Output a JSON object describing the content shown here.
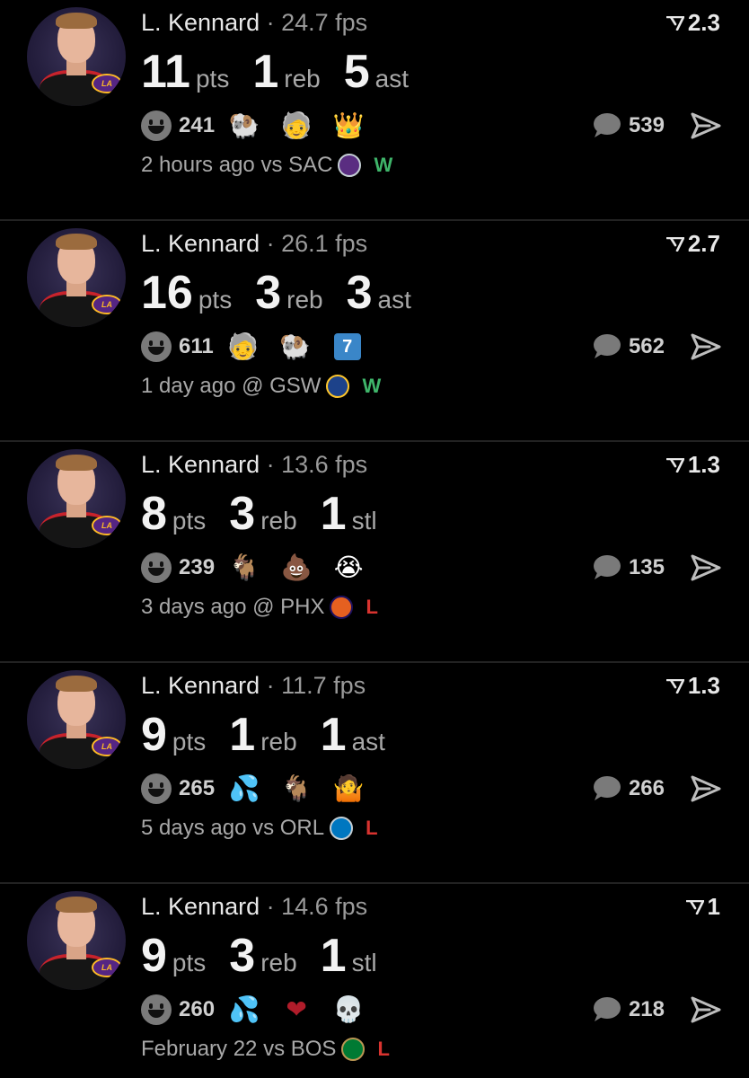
{
  "colors": {
    "background": "#000000",
    "win": "#3fb56a",
    "loss": "#d8332f",
    "divider": "#222222"
  },
  "posts": [
    {
      "player": "L. Kennard",
      "fps": "24.7 fps",
      "score": "2.3",
      "stats": [
        {
          "num": "11",
          "label": "pts"
        },
        {
          "num": "1",
          "label": "reb"
        },
        {
          "num": "5",
          "label": "ast"
        }
      ],
      "reactions_count": "241",
      "reaction_emojis": [
        "ram-emoji",
        "grandpa-meme-emoji",
        "lebron-emoji"
      ],
      "comments_count": "539",
      "time": "2 hours ago",
      "matchup": "vs SAC",
      "team_logo": "kings-logo",
      "result": "W"
    },
    {
      "player": "L. Kennard",
      "fps": "26.1 fps",
      "score": "2.7",
      "stats": [
        {
          "num": "16",
          "label": "pts"
        },
        {
          "num": "3",
          "label": "reb"
        },
        {
          "num": "3",
          "label": "ast"
        }
      ],
      "reactions_count": "611",
      "reaction_emojis": [
        "grandpa-meme-emoji",
        "ram-emoji",
        "keycap-seven-emoji"
      ],
      "comments_count": "562",
      "time": "1 day ago",
      "matchup": "@ GSW",
      "team_logo": "warriors-logo",
      "result": "W"
    },
    {
      "player": "L. Kennard",
      "fps": "13.6 fps",
      "score": "1.3",
      "stats": [
        {
          "num": "8",
          "label": "pts"
        },
        {
          "num": "3",
          "label": "reb"
        },
        {
          "num": "1",
          "label": "stl"
        }
      ],
      "reactions_count": "239",
      "reaction_emojis": [
        "goat-emoji",
        "poop-emoji",
        "crying-meme-emoji"
      ],
      "comments_count": "135",
      "time": "3 days ago",
      "matchup": "@ PHX",
      "team_logo": "suns-logo",
      "result": "L"
    },
    {
      "player": "L. Kennard",
      "fps": "11.7 fps",
      "score": "1.3",
      "stats": [
        {
          "num": "9",
          "label": "pts"
        },
        {
          "num": "1",
          "label": "reb"
        },
        {
          "num": "1",
          "label": "ast"
        }
      ],
      "reactions_count": "265",
      "reaction_emojis": [
        "sweat-droplets-emoji",
        "goat-emoji",
        "shrug-meme-emoji"
      ],
      "comments_count": "266",
      "time": "5 days ago",
      "matchup": "vs ORL",
      "team_logo": "magic-logo",
      "result": "L"
    },
    {
      "player": "L. Kennard",
      "fps": "14.6 fps",
      "score": "1",
      "stats": [
        {
          "num": "9",
          "label": "pts"
        },
        {
          "num": "3",
          "label": "reb"
        },
        {
          "num": "1",
          "label": "stl"
        }
      ],
      "reactions_count": "260",
      "reaction_emojis": [
        "sweat-droplets-emoji",
        "red-heart-emoji",
        "skull-emoji"
      ],
      "comments_count": "218",
      "time": "February 22",
      "matchup": "vs BOS",
      "team_logo": "celtics-logo",
      "result": "L"
    }
  ]
}
